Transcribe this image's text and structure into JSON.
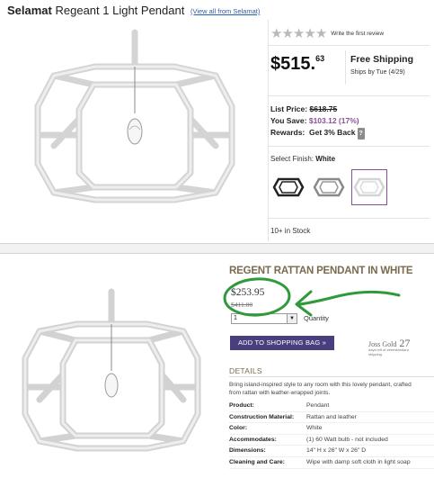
{
  "top": {
    "brand": "Selamat",
    "product_name": "Regeant 1 Light Pendant",
    "view_all": "(View all from Selamat)",
    "rating_stars": 0,
    "write_review": "Write the first review",
    "price_main": "$515.",
    "price_cents": "63",
    "free_shipping": "Free Shipping",
    "ships_by": "Ships by Tue (4/29)",
    "list_price_label": "List Price:",
    "list_price": "$618.75",
    "you_save_label": "You Save:",
    "you_save": "$103.12 (17%)",
    "rewards_label": "Rewards:",
    "rewards_value": "Get 3% Back",
    "rewards_help": "?",
    "finish_label": "Select Finish:",
    "finish_value": "White",
    "finishes": [
      "black",
      "silver",
      "white"
    ],
    "selected_finish": "white",
    "stock": "10+ in Stock"
  },
  "bottom": {
    "title": "REGENT RATTAN PENDANT IN WHITE",
    "price": "$253.95",
    "old_price": "$411.00",
    "quantity_value": "1",
    "quantity_label": "Quantity",
    "add_to_bag": "ADD TO SHOPPING BAG »",
    "joss_gold_label": "Joss Gold",
    "joss_gold_value": "27",
    "joss_gold_sub": "days left of #eeestandard shipping",
    "details_label": "DETAILS",
    "description_1": "Bring island-inspired style to any room with this lovely pendant, crafted",
    "description_2": "from rattan with leather-wrapped joints.",
    "specs": [
      {
        "key": "Product:",
        "value": "Pendant"
      },
      {
        "key": "Construction Material:",
        "value": "Rattan and leather"
      },
      {
        "key": "Color:",
        "value": "White"
      },
      {
        "key": "Accommodates:",
        "value": "(1) 60 Watt bulb - not included"
      },
      {
        "key": "Dimensions:",
        "value": "14\" H x 26\" W x 26\" D"
      },
      {
        "key": "Cleaning and Care:",
        "value": "Wipe with damp soft cloth in light soap"
      }
    ]
  },
  "colors": {
    "accent_purple": "#8a4f9a",
    "button_purple": "#4a3f7e",
    "title_brown": "#7a6a4e",
    "annotation_green": "#2e9a3a",
    "link_blue": "#2a5db0"
  }
}
